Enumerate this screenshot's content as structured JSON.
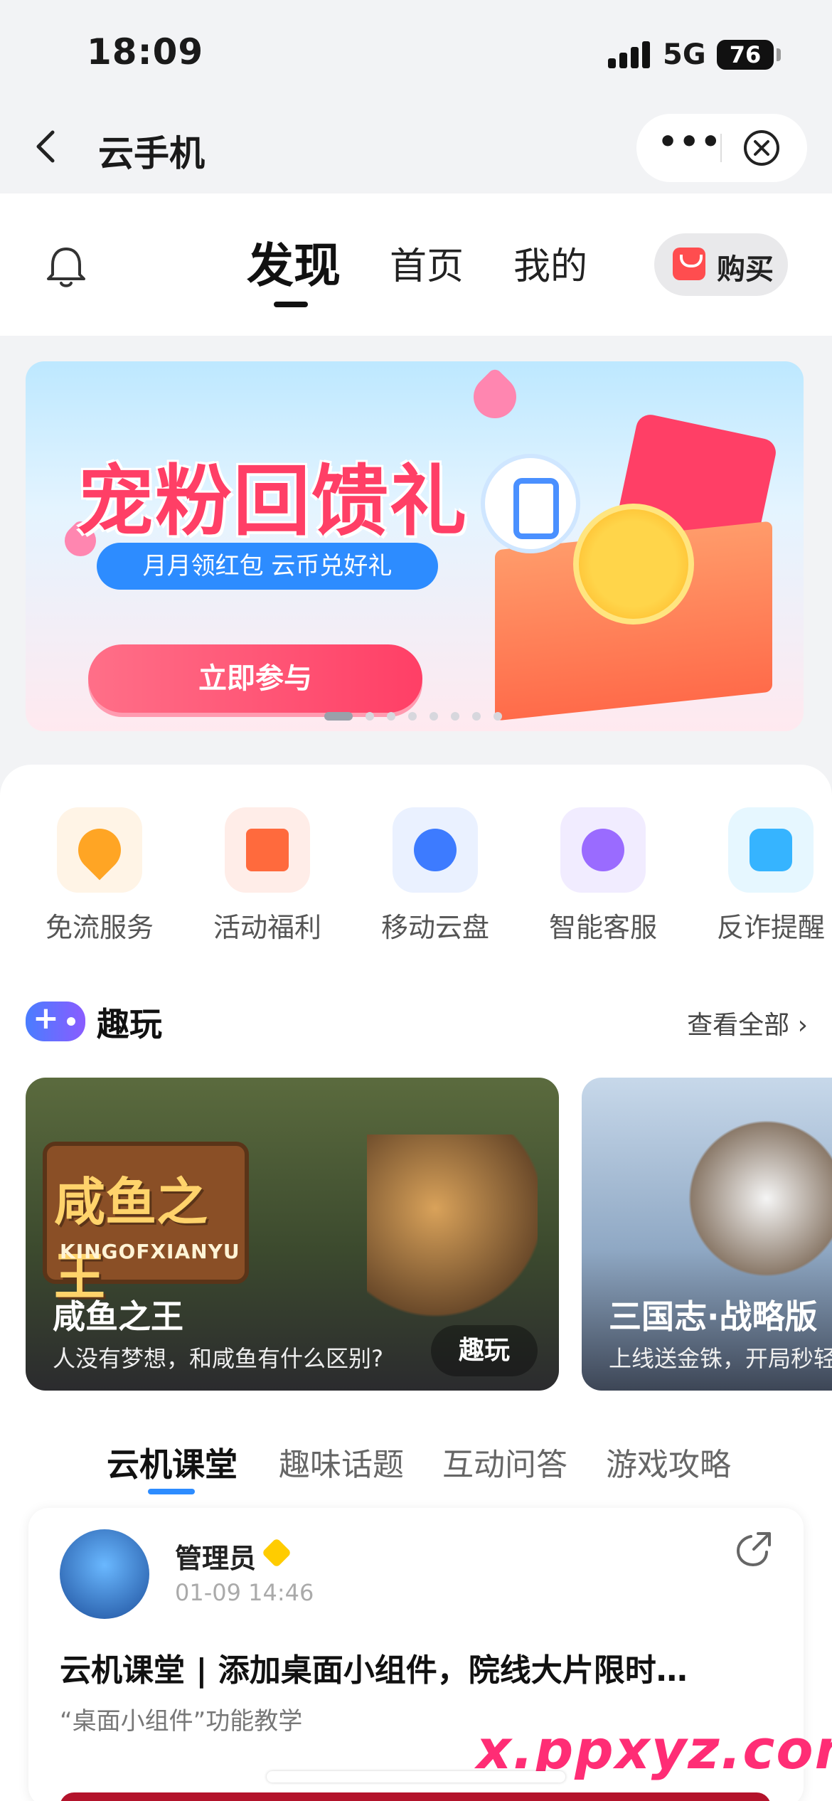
{
  "status_bar": {
    "time": "18:09",
    "network": "5G",
    "battery": "76"
  },
  "nav": {
    "title": "云手机",
    "more_icon": "more-dots-icon",
    "close_icon": "close-circle-icon"
  },
  "top_tabs": {
    "items": [
      {
        "label": "发现",
        "active": true
      },
      {
        "label": "首页",
        "active": false
      },
      {
        "label": "我的",
        "active": false
      }
    ],
    "buy_label": "购买"
  },
  "banner": {
    "title": "宠粉回馈礼",
    "subtitle": "月月领红包  云币兑好礼",
    "cta": "立即参与",
    "page_count": 8,
    "current_page": 1
  },
  "services": [
    {
      "label": "免流服务",
      "icon": "free-data-icon",
      "bg": "#fff4e6",
      "color": "#ffa524"
    },
    {
      "label": "活动福利",
      "icon": "gift-icon",
      "bg": "#ffede8",
      "color": "#ff6a3d"
    },
    {
      "label": "移动云盘",
      "icon": "cloud-drive-icon",
      "bg": "#eaf1ff",
      "color": "#3d7bff"
    },
    {
      "label": "智能客服",
      "icon": "smart-service-icon",
      "bg": "#f1ecff",
      "color": "#9a6bff"
    },
    {
      "label": "反诈提醒",
      "icon": "anti-fraud-icon",
      "bg": "#e6f7ff",
      "color": "#36b4ff"
    }
  ],
  "fun_section": {
    "title": "趣玩",
    "see_all": "查看全部"
  },
  "games": [
    {
      "name": "咸鱼之王",
      "desc": "人没有梦想，和咸鱼有什么区别?",
      "button": "趣玩",
      "logo_text": "咸鱼之王",
      "logo_sub": "KINGOFXIANYU"
    },
    {
      "name": "三国志·战略版",
      "desc": "上线送金铢，开局秒轻"
    }
  ],
  "sub_tabs": [
    {
      "label": "云机课堂",
      "active": true
    },
    {
      "label": "趣味话题",
      "active": false
    },
    {
      "label": "互动问答",
      "active": false
    },
    {
      "label": "游戏攻略",
      "active": false
    }
  ],
  "post": {
    "author": "管理员",
    "time": "01-09 14:46",
    "title": "云机课堂 | 添加桌面小组件，院线大片限时…",
    "subtitle": "“桌面小组件”功能教学"
  },
  "watermark": "x.ppxyz.com"
}
